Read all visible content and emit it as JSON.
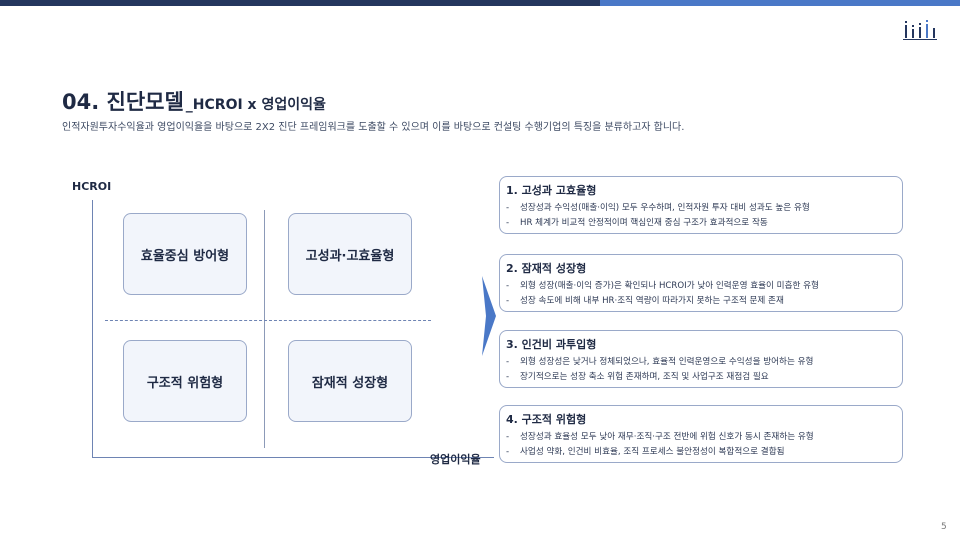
{
  "header": {
    "title": "04. 진단모델",
    "title_suffix": "_HCROI x 영업이익율",
    "subtitle": "인적자원투자수익율과 영업이익율을 바탕으로 2X2 진단 프레임워크를 도출할 수 있으며 이를 바탕으로 컨설팅 수행기업의 특징을 분류하고자 합니다."
  },
  "matrix": {
    "y_axis_label": "HCROI",
    "x_axis_label": "영업이익율",
    "quadrants": {
      "top_left": "효율중심 방어형",
      "top_right": "고성과·고효율형",
      "bottom_left": "구조적 위험형",
      "bottom_right": "잠재적 성장형"
    }
  },
  "cards": [
    {
      "title": "1. 고성과 고효율형",
      "lines": [
        "성장성과 수익성(매출·이익) 모두 우수하며, 인적자원 투자 대비 성과도 높은 유형",
        "HR 체계가 비교적 안정적이며 핵심인재 중심 구조가 효과적으로 작동"
      ]
    },
    {
      "title": "2. 잠재적 성장형",
      "lines": [
        "외형 성장(매출·이익 증가)은 확인되나 HCROI가 낮아 인력운영 효율이 미흡한 유형",
        "성장 속도에 비해 내부 HR·조직 역량이 따라가지 못하는 구조적 문제 존재"
      ]
    },
    {
      "title": "3. 인건비 과투입형",
      "lines": [
        "외형 성장성은 낮거나 정체되었으나, 효율적 인력운영으로 수익성을 방어하는 유형",
        "장기적으로는 성장 축소 위험 존재하며, 조직 및 사업구조 재점검 필요"
      ]
    },
    {
      "title": "4. 구조적 위험형",
      "lines": [
        "성장성과 효율성 모두 낮아 재무·조직·구조 전반에 위험 신호가 동시 존재하는 유형",
        "사업성 약화, 인건비 비효율, 조직 프로세스 불안정성이 복합적으로 결합됨"
      ]
    }
  ],
  "bullet_char": "-",
  "page_number": "5",
  "colors": {
    "navy": "#24365e",
    "accent_blue": "#4a78c7",
    "quadrant_fill": "#f2f5fb",
    "border": "#9aa9c9"
  },
  "icons": {
    "logo": "bar-chart-logo-icon",
    "arrow": "chevron-right-arrow-icon"
  }
}
